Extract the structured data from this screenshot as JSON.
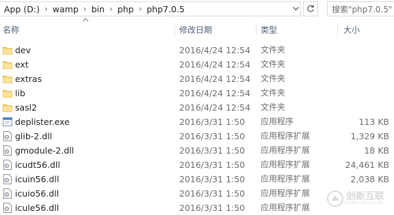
{
  "address": {
    "crumbs": [
      "App (D:)",
      "wamp",
      "bin",
      "php",
      "php7.0.5"
    ]
  },
  "search": {
    "placeholder": "搜索\"php7.0.5\""
  },
  "columns": {
    "name": "名称",
    "date": "修改日期",
    "type": "类型",
    "size": "大小"
  },
  "files": [
    {
      "name": "dev",
      "date": "2016/4/24 12:54",
      "type": "文件夹",
      "size": "",
      "icon": "folder-icon"
    },
    {
      "name": "ext",
      "date": "2016/4/24 12:54",
      "type": "文件夹",
      "size": "",
      "icon": "folder-icon"
    },
    {
      "name": "extras",
      "date": "2016/4/24 12:54",
      "type": "文件夹",
      "size": "",
      "icon": "folder-icon"
    },
    {
      "name": "lib",
      "date": "2016/4/24 12:54",
      "type": "文件夹",
      "size": "",
      "icon": "folder-icon"
    },
    {
      "name": "sasl2",
      "date": "2016/4/24 12:54",
      "type": "文件夹",
      "size": "",
      "icon": "folder-icon"
    },
    {
      "name": "deplister.exe",
      "date": "2016/3/31 1:50",
      "type": "应用程序",
      "size": "113 KB",
      "icon": "exe-icon"
    },
    {
      "name": "glib-2.dll",
      "date": "2016/3/31 1:50",
      "type": "应用程序扩展",
      "size": "1,329 KB",
      "icon": "dll-icon"
    },
    {
      "name": "gmodule-2.dll",
      "date": "2016/3/31 1:50",
      "type": "应用程序扩展",
      "size": "18 KB",
      "icon": "dll-icon"
    },
    {
      "name": "icudt56.dll",
      "date": "2016/3/31 1:50",
      "type": "应用程序扩展",
      "size": "24,461 KB",
      "icon": "dll-icon"
    },
    {
      "name": "icuin56.dll",
      "date": "2016/3/31 1:50",
      "type": "应用程序扩展",
      "size": "2,038 KB",
      "icon": "dll-icon"
    },
    {
      "name": "icuio56.dll",
      "date": "2016/3/31 1:50",
      "type": "应用程序扩展",
      "size": "",
      "icon": "dll-icon"
    },
    {
      "name": "icule56.dll",
      "date": "2016/3/31 1:50",
      "type": "应用程序扩展",
      "size": "",
      "icon": "dll-icon"
    }
  ],
  "watermark": {
    "title": "创新互联",
    "subtitle": "CHUANG XIN HU LIAN"
  }
}
